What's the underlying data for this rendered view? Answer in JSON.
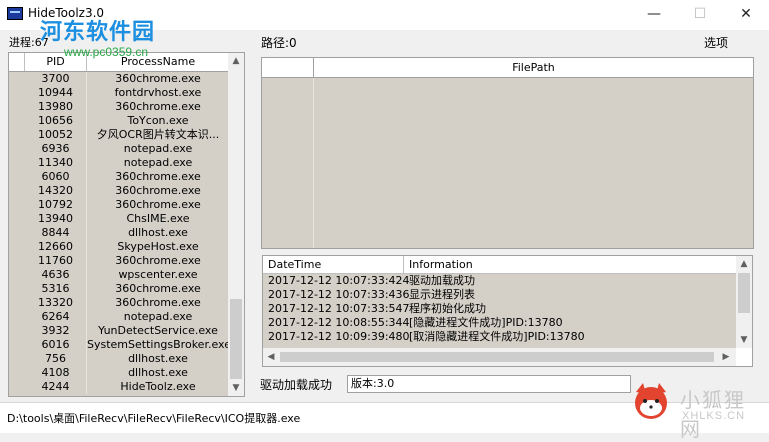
{
  "window": {
    "title": "HideToolz3.0",
    "minimize": "—",
    "maximize": "☐",
    "close": "✕"
  },
  "watermark": {
    "logo": "河东软件园",
    "url": "www.pc0359.cn",
    "corner_cn": "小狐狸网",
    "corner_en": "XHLKS.CN"
  },
  "process_panel": {
    "count_label": "进程:67",
    "columns": {
      "pid": "PID",
      "name": "ProcessName"
    },
    "rows": [
      {
        "pid": "3700",
        "name": "360chrome.exe"
      },
      {
        "pid": "10944",
        "name": "fontdrvhost.exe"
      },
      {
        "pid": "13980",
        "name": "360chrome.exe"
      },
      {
        "pid": "10656",
        "name": "ToYcon.exe"
      },
      {
        "pid": "10052",
        "name": "夕风OCR图片转文本识..."
      },
      {
        "pid": "6936",
        "name": "notepad.exe"
      },
      {
        "pid": "11340",
        "name": "notepad.exe"
      },
      {
        "pid": "6060",
        "name": "360chrome.exe"
      },
      {
        "pid": "14320",
        "name": "360chrome.exe"
      },
      {
        "pid": "10792",
        "name": "360chrome.exe"
      },
      {
        "pid": "13940",
        "name": "ChsIME.exe"
      },
      {
        "pid": "8844",
        "name": "dllhost.exe"
      },
      {
        "pid": "12660",
        "name": "SkypeHost.exe"
      },
      {
        "pid": "11760",
        "name": "360chrome.exe"
      },
      {
        "pid": "4636",
        "name": "wpscenter.exe"
      },
      {
        "pid": "5316",
        "name": "360chrome.exe"
      },
      {
        "pid": "13320",
        "name": "360chrome.exe"
      },
      {
        "pid": "6264",
        "name": "notepad.exe"
      },
      {
        "pid": "3932",
        "name": "YunDetectService.exe"
      },
      {
        "pid": "6016",
        "name": "SystemSettingsBroker.exe"
      },
      {
        "pid": "756",
        "name": "dllhost.exe"
      },
      {
        "pid": "4108",
        "name": "dllhost.exe"
      },
      {
        "pid": "4244",
        "name": "HideToolz.exe"
      }
    ]
  },
  "file_panel": {
    "path_label": "路径:0",
    "options_label": "选项",
    "column_filepath": "FilePath"
  },
  "log_panel": {
    "columns": {
      "datetime": "DateTime",
      "information": "Information"
    },
    "rows": [
      {
        "datetime": "2017-12-12 10:07:33:424",
        "information": "驱动加载成功"
      },
      {
        "datetime": "2017-12-12 10:07:33:436",
        "information": "显示进程列表"
      },
      {
        "datetime": "2017-12-12 10:07:33:547",
        "information": "程序初始化成功"
      },
      {
        "datetime": "2017-12-12 10:08:55:344",
        "information": "[隐藏进程文件成功]PID:13780"
      },
      {
        "datetime": "2017-12-12 10:09:39:480",
        "information": "[取消隐藏进程文件成功]PID:13780"
      }
    ]
  },
  "status": {
    "driver": "驱动加载成功",
    "version": "版本:3.0"
  },
  "bottom_path": "D:\\tools\\桌面\\FileRecv\\FileRecv\\FileRecv\\ICO提取器.exe"
}
